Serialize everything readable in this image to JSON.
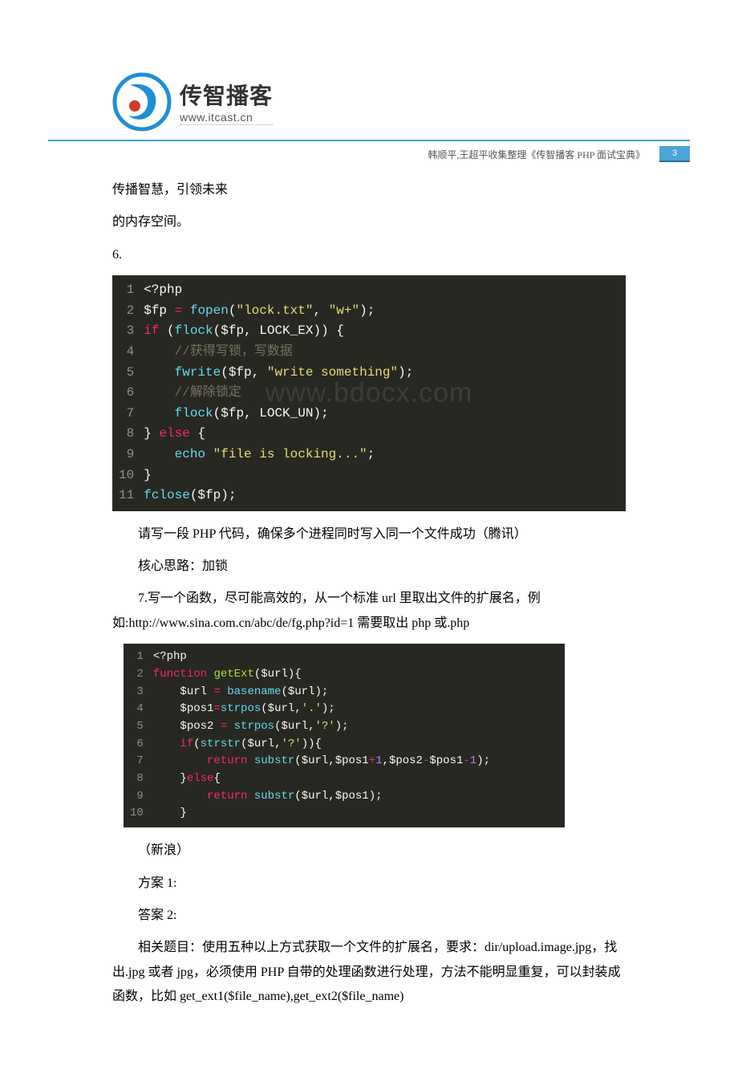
{
  "header": {
    "logo_cn": "传智播客",
    "logo_url": "www.itcast.cn",
    "sub_note": "韩顺平,王超平收集整理《传智播客 PHP 面试宝典》",
    "page_num": "3"
  },
  "intro": {
    "line1": "传播智慧，引领未来",
    "line2": "的内存空间。",
    "q6": "6."
  },
  "code1": {
    "lines": [
      {
        "n": "1",
        "seg": [
          {
            "c": "tok-tag",
            "t": "<?php"
          }
        ]
      },
      {
        "n": "2",
        "seg": [
          {
            "c": "tok-var",
            "t": "$fp"
          },
          {
            "c": "tok-pun",
            "t": " "
          },
          {
            "c": "tok-op",
            "t": "="
          },
          {
            "c": "tok-pun",
            "t": " "
          },
          {
            "c": "tok-fn",
            "t": "fopen"
          },
          {
            "c": "tok-pun",
            "t": "("
          },
          {
            "c": "tok-str",
            "t": "\"lock.txt\""
          },
          {
            "c": "tok-pun",
            "t": ", "
          },
          {
            "c": "tok-str",
            "t": "\"w+\""
          },
          {
            "c": "tok-pun",
            "t": ");"
          }
        ]
      },
      {
        "n": "3",
        "seg": [
          {
            "c": "tok-kw",
            "t": "if"
          },
          {
            "c": "tok-pun",
            "t": " ("
          },
          {
            "c": "tok-fn",
            "t": "flock"
          },
          {
            "c": "tok-pun",
            "t": "("
          },
          {
            "c": "tok-var",
            "t": "$fp"
          },
          {
            "c": "tok-pun",
            "t": ", LOCK_EX)) {"
          }
        ]
      },
      {
        "n": "4",
        "seg": [
          {
            "c": "tok-pun",
            "t": "    "
          },
          {
            "c": "tok-cmt",
            "t": "//获得写锁，写数据"
          }
        ]
      },
      {
        "n": "5",
        "seg": [
          {
            "c": "tok-pun",
            "t": "    "
          },
          {
            "c": "tok-fn",
            "t": "fwrite"
          },
          {
            "c": "tok-pun",
            "t": "("
          },
          {
            "c": "tok-var",
            "t": "$fp"
          },
          {
            "c": "tok-pun",
            "t": ", "
          },
          {
            "c": "tok-str",
            "t": "\"write something\""
          },
          {
            "c": "tok-pun",
            "t": ");"
          }
        ]
      },
      {
        "n": "6",
        "seg": [
          {
            "c": "tok-pun",
            "t": "    "
          },
          {
            "c": "tok-cmt",
            "t": "//解除锁定"
          }
        ]
      },
      {
        "n": "7",
        "seg": [
          {
            "c": "tok-pun",
            "t": "    "
          },
          {
            "c": "tok-fn",
            "t": "flock"
          },
          {
            "c": "tok-pun",
            "t": "("
          },
          {
            "c": "tok-var",
            "t": "$fp"
          },
          {
            "c": "tok-pun",
            "t": ", LOCK_UN);"
          }
        ]
      },
      {
        "n": "8",
        "seg": [
          {
            "c": "tok-pun",
            "t": "} "
          },
          {
            "c": "tok-kw",
            "t": "else"
          },
          {
            "c": "tok-pun",
            "t": " {"
          }
        ]
      },
      {
        "n": "9",
        "seg": [
          {
            "c": "tok-pun",
            "t": "    "
          },
          {
            "c": "tok-fn",
            "t": "echo"
          },
          {
            "c": "tok-pun",
            "t": " "
          },
          {
            "c": "tok-str",
            "t": "\"file is locking...\""
          },
          {
            "c": "tok-pun",
            "t": ";"
          }
        ]
      },
      {
        "n": "10",
        "seg": [
          {
            "c": "tok-pun",
            "t": "}"
          }
        ]
      },
      {
        "n": "11",
        "seg": [
          {
            "c": "tok-fn",
            "t": "fclose"
          },
          {
            "c": "tok-pun",
            "t": "("
          },
          {
            "c": "tok-var",
            "t": "$fp"
          },
          {
            "c": "tok-pun",
            "t": ");"
          }
        ]
      }
    ]
  },
  "after_code1": {
    "p1": "请写一段 PHP 代码，确保多个进程同时写入同一个文件成功（腾讯）",
    "p2": "核心思路：加锁",
    "q7": "7.写一个函数，尽可能高效的，从一个标准 url 里取出文件的扩展名，例如:http://www.sina.com.cn/abc/de/fg.php?id=1 需要取出 php 或.php"
  },
  "code2": {
    "lines": [
      {
        "n": "1",
        "seg": [
          {
            "c": "tok-tag",
            "t": "<?php"
          }
        ]
      },
      {
        "n": "2",
        "seg": [
          {
            "c": "tok-kw",
            "t": "function"
          },
          {
            "c": "tok-pun",
            "t": " "
          },
          {
            "c": "tok-name",
            "t": "getExt"
          },
          {
            "c": "tok-pun",
            "t": "("
          },
          {
            "c": "tok-var",
            "t": "$url"
          },
          {
            "c": "tok-pun",
            "t": "){"
          }
        ]
      },
      {
        "n": "3",
        "seg": [
          {
            "c": "tok-pun",
            "t": "    "
          },
          {
            "c": "tok-var",
            "t": "$url"
          },
          {
            "c": "tok-pun",
            "t": " "
          },
          {
            "c": "tok-op",
            "t": "="
          },
          {
            "c": "tok-pun",
            "t": " "
          },
          {
            "c": "tok-fn",
            "t": "basename"
          },
          {
            "c": "tok-pun",
            "t": "("
          },
          {
            "c": "tok-var",
            "t": "$url"
          },
          {
            "c": "tok-pun",
            "t": ");"
          }
        ]
      },
      {
        "n": "4",
        "seg": [
          {
            "c": "tok-pun",
            "t": "    "
          },
          {
            "c": "tok-var",
            "t": "$pos1"
          },
          {
            "c": "tok-op",
            "t": "="
          },
          {
            "c": "tok-fn",
            "t": "strpos"
          },
          {
            "c": "tok-pun",
            "t": "("
          },
          {
            "c": "tok-var",
            "t": "$url"
          },
          {
            "c": "tok-pun",
            "t": ","
          },
          {
            "c": "tok-str",
            "t": "'.'"
          },
          {
            "c": "tok-pun",
            "t": ");"
          }
        ]
      },
      {
        "n": "5",
        "seg": [
          {
            "c": "tok-pun",
            "t": "    "
          },
          {
            "c": "tok-var",
            "t": "$pos2"
          },
          {
            "c": "tok-pun",
            "t": " "
          },
          {
            "c": "tok-op",
            "t": "="
          },
          {
            "c": "tok-pun",
            "t": " "
          },
          {
            "c": "tok-fn",
            "t": "strpos"
          },
          {
            "c": "tok-pun",
            "t": "("
          },
          {
            "c": "tok-var",
            "t": "$url"
          },
          {
            "c": "tok-pun",
            "t": ","
          },
          {
            "c": "tok-str",
            "t": "'?'"
          },
          {
            "c": "tok-pun",
            "t": ");"
          }
        ]
      },
      {
        "n": "6",
        "seg": [
          {
            "c": "tok-pun",
            "t": "    "
          },
          {
            "c": "tok-kw",
            "t": "if"
          },
          {
            "c": "tok-pun",
            "t": "("
          },
          {
            "c": "tok-fn",
            "t": "strstr"
          },
          {
            "c": "tok-pun",
            "t": "("
          },
          {
            "c": "tok-var",
            "t": "$url"
          },
          {
            "c": "tok-pun",
            "t": ","
          },
          {
            "c": "tok-str",
            "t": "'?'"
          },
          {
            "c": "tok-pun",
            "t": ")){"
          }
        ]
      },
      {
        "n": "7",
        "seg": [
          {
            "c": "tok-pun",
            "t": "        "
          },
          {
            "c": "tok-kw",
            "t": "return"
          },
          {
            "c": "tok-pun",
            "t": " "
          },
          {
            "c": "tok-fn",
            "t": "substr"
          },
          {
            "c": "tok-pun",
            "t": "("
          },
          {
            "c": "tok-var",
            "t": "$url"
          },
          {
            "c": "tok-pun",
            "t": ","
          },
          {
            "c": "tok-var",
            "t": "$pos1"
          },
          {
            "c": "tok-op",
            "t": "+"
          },
          {
            "c": "tok-num",
            "t": "1"
          },
          {
            "c": "tok-pun",
            "t": ","
          },
          {
            "c": "tok-var",
            "t": "$pos2"
          },
          {
            "c": "tok-op",
            "t": "-"
          },
          {
            "c": "tok-var",
            "t": "$pos1"
          },
          {
            "c": "tok-op",
            "t": "-"
          },
          {
            "c": "tok-num",
            "t": "1"
          },
          {
            "c": "tok-pun",
            "t": ");"
          }
        ]
      },
      {
        "n": "8",
        "seg": [
          {
            "c": "tok-pun",
            "t": "    }"
          },
          {
            "c": "tok-kw",
            "t": "else"
          },
          {
            "c": "tok-pun",
            "t": "{"
          }
        ]
      },
      {
        "n": "9",
        "seg": [
          {
            "c": "tok-pun",
            "t": "        "
          },
          {
            "c": "tok-kw",
            "t": "return"
          },
          {
            "c": "tok-pun",
            "t": " "
          },
          {
            "c": "tok-fn",
            "t": "substr"
          },
          {
            "c": "tok-pun",
            "t": "("
          },
          {
            "c": "tok-var",
            "t": "$url"
          },
          {
            "c": "tok-pun",
            "t": ","
          },
          {
            "c": "tok-var",
            "t": "$pos1"
          },
          {
            "c": "tok-pun",
            "t": ");"
          }
        ]
      },
      {
        "n": "10",
        "seg": [
          {
            "c": "tok-pun",
            "t": "    }"
          }
        ]
      }
    ]
  },
  "after_code2": {
    "p1": "（新浪）",
    "p2": "方案 1:",
    "p3": "答案 2:",
    "p4": "相关题目：使用五种以上方式获取一个文件的扩展名，要求：dir/upload.image.jpg，找出.jpg 或者 jpg，必须使用 PHP 自带的处理函数进行处理，方法不能明显重复，可以封装成函数，比如 get_ext1($file_name),get_ext2($file_name)"
  },
  "watermark": "www.bdocx.com"
}
